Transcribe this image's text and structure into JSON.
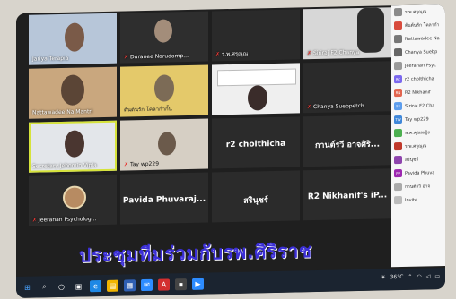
{
  "tiles": {
    "t1": "Jariya Terapia",
    "t2": "Duranee Narudomp...",
    "t3": "ร.พ.ศรุณุณ",
    "t4": "Siriraj F2 Chanya",
    "t5": "Nattawadee Na Mantri",
    "t6": "ต้นต้นรัก โคลากำกั้น",
    "t7": "Chanya Suebpetch",
    "t8": "Secretary Jehomin Vipla",
    "t9": "Tay wp229",
    "t10_center": "r2 cholthicha",
    "t11_center": "กานต์รวี  อาจศิริ...",
    "t12": "Jeeranan Psycholog...",
    "t13_center": "Pavida  Phuvaraj...",
    "t14_center": "สรินุชร์",
    "t15_center": "R2  Nikhanif's iP..."
  },
  "sidebar": [
    {
      "badge": "",
      "label": "ร.พ.ศรุณุณ",
      "color": "#8a8a8a"
    },
    {
      "badge": "",
      "label": "ต้นต้นรัก โคลากำ",
      "color": "#d84b3c"
    },
    {
      "badge": "",
      "label": "Nattawadee Na",
      "color": "#777"
    },
    {
      "badge": "",
      "label": "Chanya Suebp",
      "color": "#666"
    },
    {
      "badge": "",
      "label": "Jeeranan Psyc",
      "color": "#999"
    },
    {
      "badge": "RC",
      "label": "r2 cholthicha",
      "color": "#7b68ee"
    },
    {
      "badge": "RN",
      "label": "R2 Nikhanif",
      "color": "#e2654f"
    },
    {
      "badge": "SF",
      "label": "Siriraj F2 Cha",
      "color": "#5c9ded"
    },
    {
      "badge": "TW",
      "label": "Tay wp229",
      "color": "#3f87d9"
    },
    {
      "badge": "",
      "label": "พ.ค.คุณหญิง",
      "color": "#4caf50"
    },
    {
      "badge": "",
      "label": "ร.พ.ศรุณุณ",
      "color": "#c0392b"
    },
    {
      "badge": "",
      "label": "สรินุชร์",
      "color": "#8e44ad"
    },
    {
      "badge": "PP",
      "label": "Pavida Phuva",
      "color": "#9c27b0"
    },
    {
      "badge": "",
      "label": "กานต์รวี อาจ",
      "color": "#aaa"
    },
    {
      "badge": "",
      "label": "Invite",
      "color": "#bbb"
    }
  ],
  "caption": "ประชุมทีมร่วมกับรพ.ศิริราช",
  "tray": {
    "temp": "36°C",
    "time": "",
    "lang": "ENG"
  }
}
